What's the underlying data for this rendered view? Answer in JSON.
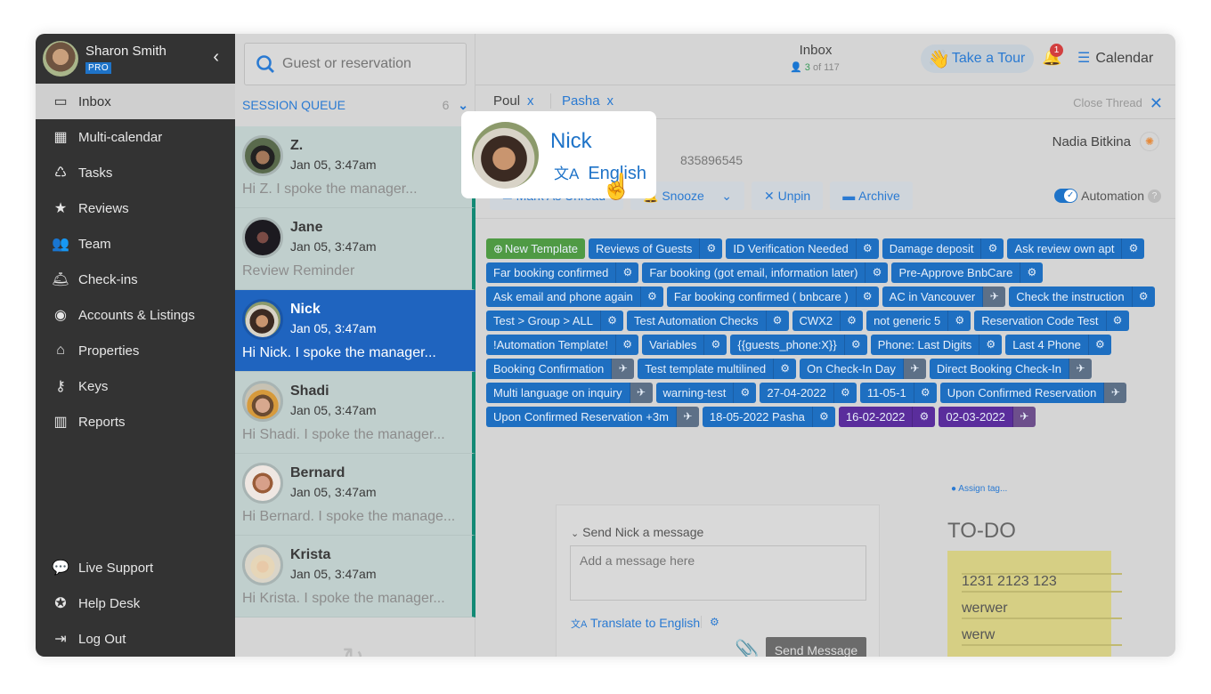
{
  "sidebar": {
    "user_name": "Sharon Smith",
    "plan_badge": "PRO",
    "collapse_icon": "‹",
    "items": [
      {
        "label": "Inbox",
        "icon": "▭"
      },
      {
        "label": "Multi-calendar",
        "icon": "▦"
      },
      {
        "label": "Tasks",
        "icon": "♺"
      },
      {
        "label": "Reviews",
        "icon": "★"
      },
      {
        "label": "Team",
        "icon": "👥"
      },
      {
        "label": "Check-ins",
        "icon": "🛎"
      },
      {
        "label": "Accounts & Listings",
        "icon": "◉"
      },
      {
        "label": "Properties",
        "icon": "⌂"
      },
      {
        "label": "Keys",
        "icon": "⚷"
      },
      {
        "label": "Reports",
        "icon": "▥"
      }
    ],
    "bottom_items": [
      {
        "label": "Live Support",
        "icon": "💬"
      },
      {
        "label": "Help Desk",
        "icon": "✪"
      },
      {
        "label": "Log Out",
        "icon": "⇥"
      }
    ]
  },
  "queue": {
    "search_placeholder": "Guest or reservation",
    "section_label": "SESSION QUEUE",
    "section_count": "6",
    "conversations": [
      {
        "name": "Z.",
        "time": "Jan 05, 3:47am",
        "preview": "Hi Z. I spoke the manager..."
      },
      {
        "name": "Jane",
        "time": "Jan 05, 3:47am",
        "preview": "Review Reminder"
      },
      {
        "name": "Nick",
        "time": "Jan 05, 3:47am",
        "preview": "Hi Nick. I spoke the manager..."
      },
      {
        "name": "Shadi",
        "time": "Jan 05, 3:47am",
        "preview": "Hi Shadi. I spoke the manager..."
      },
      {
        "name": "Bernard",
        "time": "Jan 05, 3:47am",
        "preview": "Hi Bernard. I spoke the manage..."
      },
      {
        "name": "Krista",
        "time": "Jan 05, 3:47am",
        "preview": "Hi Krista. I spoke the manager..."
      }
    ]
  },
  "header": {
    "title": "Inbox",
    "count_current": "3",
    "count_total": "of 117",
    "tour_label": "Take a Tour",
    "notification_count": "1",
    "calendar_label": "Calendar"
  },
  "tabs": [
    {
      "label": "Poul",
      "close": "x"
    },
    {
      "label": "Pasha",
      "close": "x"
    }
  ],
  "close_thread_label": "Close Thread",
  "guest": {
    "name": "Nick",
    "language": "English",
    "phone_partial": "835896545",
    "assignee": "Nadia Bitkina"
  },
  "actions": {
    "mark_unread": "Mark As Unread",
    "snooze": "Snooze",
    "unpin": "Unpin",
    "archive": "Archive",
    "automation": "Automation",
    "automation_enabled": true
  },
  "templates": [
    {
      "label": "New Template",
      "type": "new"
    },
    {
      "label": "Reviews of Guests",
      "icon": "gear"
    },
    {
      "label": "ID Verification Needed",
      "icon": "gear"
    },
    {
      "label": "Damage deposit",
      "icon": "gear"
    },
    {
      "label": "Ask review own apt",
      "icon": "gear"
    },
    {
      "label": "Far booking confirmed",
      "icon": "gear"
    },
    {
      "label": "Far booking (got email, information later)",
      "icon": "gear"
    },
    {
      "label": "Pre-Approve BnbCare",
      "icon": "gear"
    },
    {
      "label": "Ask email and phone again",
      "icon": "gear"
    },
    {
      "label": "Far booking confirmed ( bnbcare )",
      "icon": "gear"
    },
    {
      "label": "AC in Vancouver",
      "icon": "plane"
    },
    {
      "label": "Check the instruction",
      "icon": "gear"
    },
    {
      "label": "Test > Group > ALL",
      "icon": "gear"
    },
    {
      "label": "Test Automation Checks",
      "icon": "gear"
    },
    {
      "label": "CWX2",
      "icon": "gear"
    },
    {
      "label": "not generic 5",
      "icon": "gear"
    },
    {
      "label": "Reservation Code Test",
      "icon": "gear"
    },
    {
      "label": "!Automation Template!",
      "icon": "gear"
    },
    {
      "label": "Variables",
      "icon": "gear"
    },
    {
      "label": "{{guests_phone:X}}",
      "icon": "gear"
    },
    {
      "label": "Phone: Last Digits",
      "icon": "gear"
    },
    {
      "label": "Last 4 Phone",
      "icon": "gear"
    },
    {
      "label": "Booking Confirmation",
      "icon": "plane"
    },
    {
      "label": "Test template multilined",
      "icon": "gear"
    },
    {
      "label": "On Check-In Day",
      "icon": "plane"
    },
    {
      "label": "Direct Booking Check-In",
      "icon": "plane"
    },
    {
      "label": "Multi language on inquiry",
      "icon": "plane"
    },
    {
      "label": "warning-test",
      "icon": "gear"
    },
    {
      "label": "27-04-2022",
      "icon": "gear"
    },
    {
      "label": "11-05-1",
      "icon": "gear"
    },
    {
      "label": "Upon Confirmed Reservation",
      "icon": "plane"
    },
    {
      "label": "Upon Confirmed Reservation +3m",
      "icon": "plane"
    },
    {
      "label": "18-05-2022 Pasha",
      "icon": "gear"
    },
    {
      "label": "16-02-2022",
      "icon": "gear",
      "color": "purple"
    },
    {
      "label": "02-03-2022",
      "icon": "plane",
      "color": "purple"
    }
  ],
  "compose": {
    "title": "Send Nick a message",
    "placeholder": "Add a message here",
    "translate_label": "Translate to English",
    "send_label": "Send Message"
  },
  "assign_tag_label": "Assign tag...",
  "todo": {
    "title": "TO-DO",
    "items": [
      "1231 2123 123",
      "werwer",
      "werw"
    ]
  }
}
